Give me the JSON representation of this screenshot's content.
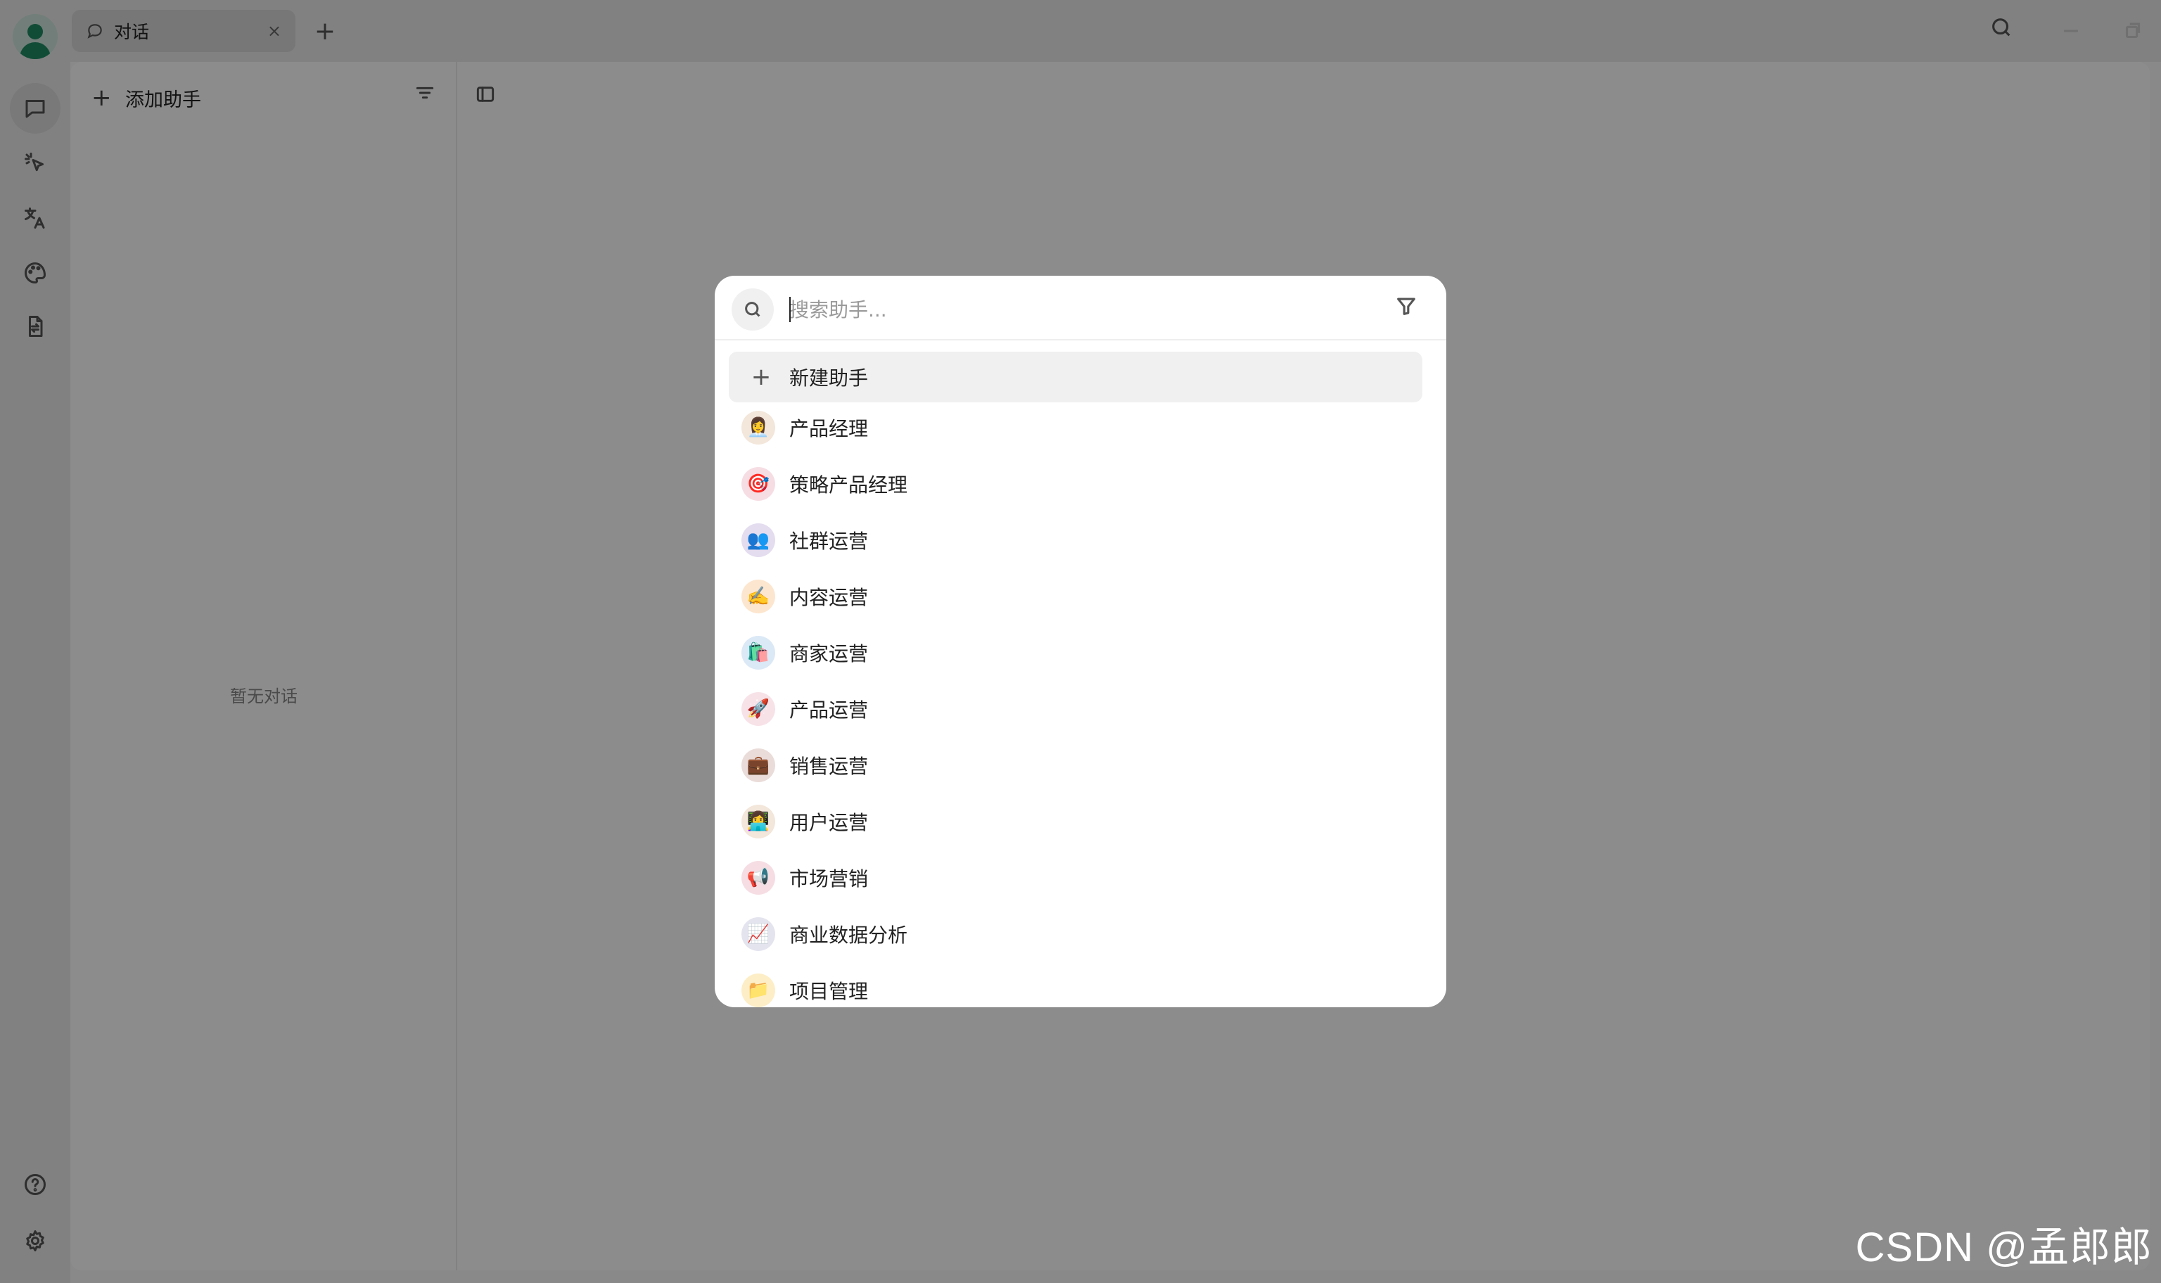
{
  "titlebar": {
    "tab_label": "对话",
    "tab_close": "×",
    "tab_add": "+"
  },
  "sidebar": {
    "add_label": "添加助手",
    "empty_text": "暂无对话"
  },
  "modal": {
    "search_placeholder": "搜索助手...",
    "new_label": "新建助手",
    "items": [
      {
        "label": "产品经理",
        "emoji": "👩‍💼",
        "bg": "#f3e6da"
      },
      {
        "label": "策略产品经理",
        "emoji": "🎯",
        "bg": "#f6dde4"
      },
      {
        "label": "社群运营",
        "emoji": "👥",
        "bg": "#e4dcef"
      },
      {
        "label": "内容运营",
        "emoji": "✍️",
        "bg": "#fde6cf"
      },
      {
        "label": "商家运营",
        "emoji": "🛍️",
        "bg": "#dbe8f6"
      },
      {
        "label": "产品运营",
        "emoji": "🚀",
        "bg": "#f7e2e8"
      },
      {
        "label": "销售运营",
        "emoji": "💼",
        "bg": "#eadcd9"
      },
      {
        "label": "用户运营",
        "emoji": "👩‍💻",
        "bg": "#f3e6da"
      },
      {
        "label": "市场营销",
        "emoji": "📢",
        "bg": "#f6dde4"
      },
      {
        "label": "商业数据分析",
        "emoji": "📈",
        "bg": "#e4e4ef"
      },
      {
        "label": "项目管理",
        "emoji": "📁",
        "bg": "#fdeec7"
      }
    ]
  },
  "watermark": "CSDN @孟郎郎"
}
